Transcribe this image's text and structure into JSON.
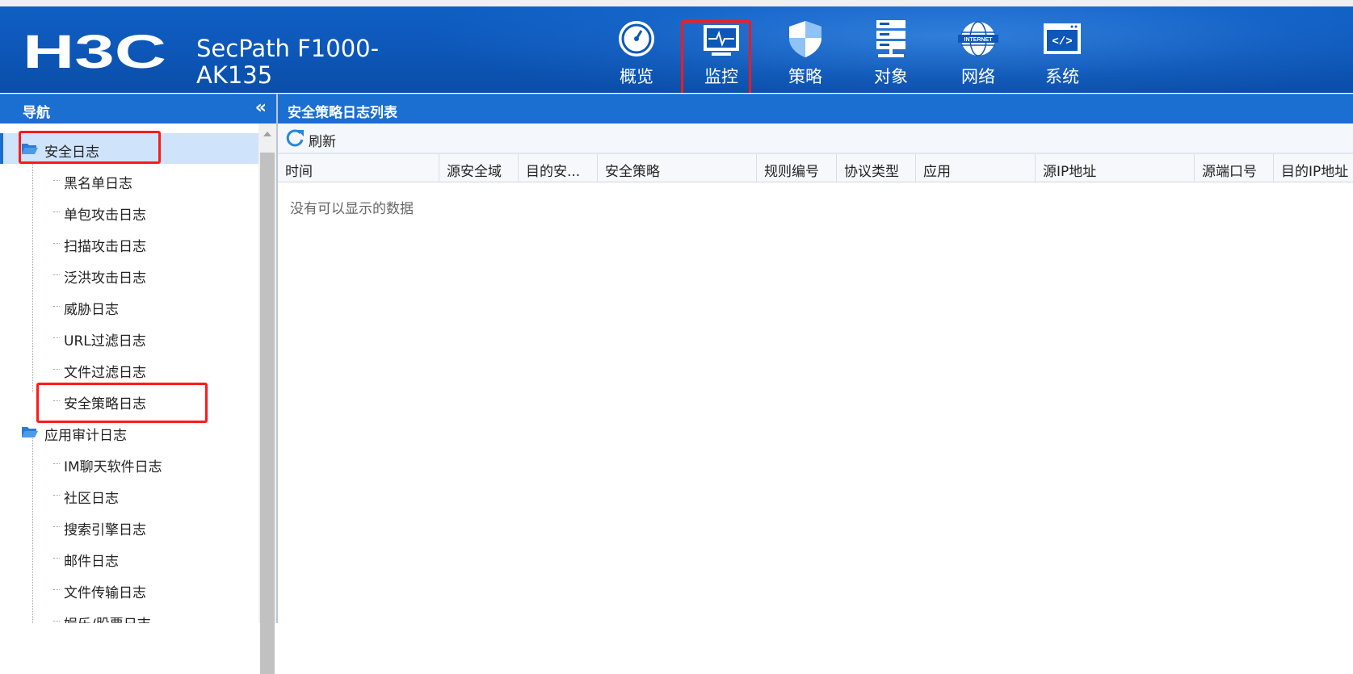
{
  "header": {
    "product_line1": "SecPath F1000-",
    "product_line2": "AK135",
    "logo_text": "H3C",
    "nav": [
      {
        "label": "概览",
        "icon": "gauge-icon"
      },
      {
        "label": "监控",
        "icon": "monitor-icon",
        "active": true
      },
      {
        "label": "策略",
        "icon": "shield-icon"
      },
      {
        "label": "对象",
        "icon": "server-stack-icon"
      },
      {
        "label": "网络",
        "icon": "internet-globe-icon"
      },
      {
        "label": "系统",
        "icon": "code-window-icon"
      }
    ]
  },
  "sidebar": {
    "title": "导航",
    "collapse_glyph": "«",
    "groups": [
      {
        "label": "安全日志",
        "items": [
          "黑名单日志",
          "单包攻击日志",
          "扫描攻击日志",
          "泛洪攻击日志",
          "威胁日志",
          "URL过滤日志",
          "文件过滤日志",
          "安全策略日志"
        ]
      },
      {
        "label": "应用审计日志",
        "items": [
          "IM聊天软件日志",
          "社区日志",
          "搜索引擎日志",
          "邮件日志",
          "文件传输日志",
          "娱乐/股票日志"
        ]
      }
    ]
  },
  "main": {
    "title": "安全策略日志列表",
    "refresh_label": "刷新",
    "columns": [
      "时间",
      "源安全域",
      "目的安...",
      "安全策略",
      "规则编号",
      "协议类型",
      "应用",
      "源IP地址",
      "源端口号",
      "目的IP地址"
    ],
    "empty_message": "没有可以显示的数据"
  },
  "colors": {
    "header_blue": "#0d57b8",
    "panel_header_blue": "#1b6fd1",
    "highlight_red": "#ff1a1a",
    "selected_row": "#cfe3fb"
  }
}
